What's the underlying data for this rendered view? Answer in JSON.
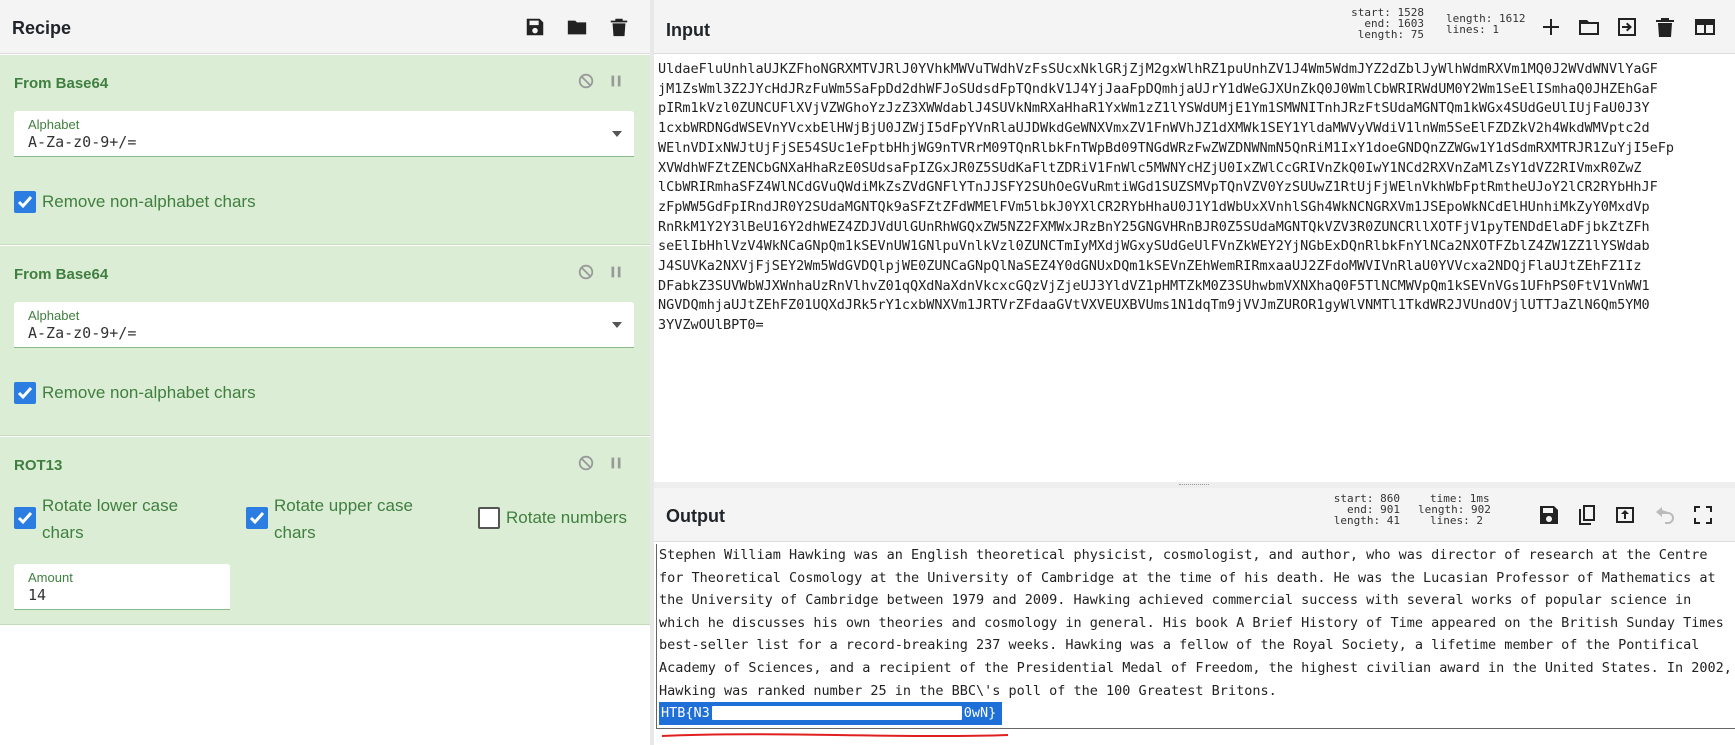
{
  "recipe": {
    "title": "Recipe",
    "icons": [
      "save-icon",
      "folder-icon",
      "trash-icon"
    ],
    "operations": [
      {
        "name": "From Base64",
        "alphabet_label": "Alphabet",
        "alphabet_value": "A-Za-z0-9+/=",
        "checkbox_label": "Remove non-alphabet chars",
        "checked": true
      },
      {
        "name": "From Base64",
        "alphabet_label": "Alphabet",
        "alphabet_value": "A-Za-z0-9+/=",
        "checkbox_label": "Remove non-alphabet chars",
        "checked": true
      },
      {
        "name": "ROT13",
        "opt_lower": "Rotate lower case chars",
        "opt_upper": "Rotate upper case chars",
        "opt_numbers": "Rotate numbers",
        "lower_checked": true,
        "upper_checked": true,
        "numbers_checked": false,
        "amount_label": "Amount",
        "amount_value": "14"
      }
    ]
  },
  "input": {
    "title": "Input",
    "stats": {
      "start": "start: 1528",
      "end": "end: 1603",
      "length": "length: 75",
      "total_length": "length: 1612",
      "lines": "lines: 1"
    },
    "icons": [
      "plus-icon",
      "open-folder-icon",
      "import-icon",
      "trash-icon",
      "layout-icon"
    ],
    "lines": [
      "UldaeFluUnhlaUJKZFhoNGRXMTVJRlJ0YVhkMWVuTWdhVzFsSUcxNklGRjZjM2gxWlhRZ1puUnhZV1J4Wm5WdmJYZ2dZblJyWlhWdmRXVm1MQ0J2WVdWNVlYaGF",
      "jM1ZsWml3Z2JYcHdJRzFuWm5SaFpDd2dhWFJoSUdsdFpTQndkV1J4YjJaaFpDQmhjaUJrY1dWeGJXUnZkQ0J0WmlCbWRIRWdUM0Y2Wm1SeElISmhaQ0JHZEhGaF",
      "pIRm1kVzl0ZUNCUFlXVjVZWGhoYzJzZ3XWWdablJ4SUVkNmRXaHhaR1YxWm1zZ1lYSWdUMjE1Ym1SMWNITnhJRzFtSUdaMGNTQm1kWGx4SUdGeUlIUjFaU0J3Y",
      "1cxbWRDNGdWSEVnYVcxbElHWjBjU0JZWjI5dFpYVnRlaUJDWkdGeWNXVmxZV1FnWVhJZ1dXMWk1SEY1YldaMWVyVWdiV1lnWm5SeElFZDZkV2h4WkdWMVptc2d",
      "WElnVDIxNWJtUjFjSE54SUc1eFptbHhjWG9nTVRrM09TQnRlbkFnTWpBd09TNGdWRzFwZWZDNWNmN5QnRiM1IxY1doeGNDQnZZWGw1Y1dSdmRXMTRJR1ZuYjI5eFp",
      "XVWdhWFZtZENCbGNXaHhaRzE0SUdsaFpIZGxJR0Z5SUdKaFltZDRiV1FnWlc5MWNYcHZjU0IxZWlCcGRIVnZkQ0IwY1NCd2RXVnZaMlZsY1dVZ2RIVmxR0ZwZ",
      "lCbWRIRmhaSFZ4WlNCdGVuQWdiMkZsZVdGNFlYTnJJSFY2SUhOeGVuRmtiWGd1SUZSMVpTQnVZV0YzSUUwZ1RtUjFjWElnVkhWbFptRmtheUJoY2lCR2RYbHhJF",
      "zFpWW5GdFpIRndJR0Y2SUdaMGNTQk9aSFZtZFdWMElFVm5lbkJ0YXlCR2RYbHhaU0J1Y1dWbUxXVnhlSGh4WkNCNGRXVm1JSEpoWkNCdElHUnhiMkZyY0MxdVp",
      "RnRkM1Y2Y3lBeU16Y2dhWEZ4ZDJVdUlGUnRhWGQxZW5NZ2FXMWxJRzBnY25GNGVHRnBJR0Z5SUdaMGNTQkVZV3R0ZUNCRllXOTFjV1pyTENDdElaDFjbkZtZFh",
      "seElIbHhlVzV4WkNCaGNpQm1kSEVnUW1GNlpuVnlkVzl0ZUNCTmIyMXdjWGxySUdGeUlFVnZkWEY2YjNGbExDQnRlbkFnYlNCa2NXOTFZblZ4ZW1ZZ1lYSWdab",
      "J4SUVKa2NXVjFjSEY2Wm5WdGVDQlpjWE0ZUNCaGNpQlNaSEZ4Y0dGNUxDQm1kSEVnZEhWemRIRmxaaUJ2ZFdoMWVIVnRlaU0YVVcxa2NDQjFlaUJtZEhFZ1Iz",
      "DFabkZ3SUVWbWJXWnhaUzRnVlhvZ01qQXdNaXdnVkcxcGQzVjZjeUJ3YldVZ1pHMTZkM0Z3SUhwbmVXNXhaQ0F5TlNCMWVpQm1kSEVnVGs1UFhPS0FtV1VnWW1",
      "NGVDQmhjaUJtZEhFZ01UQXdJRk5rY1cxbWNXVm1JRTVrZFdaaGVtVXVEUXBVUms1N1dqTm9jVVJmZUROR1gyWlVNMTl1TkdWR2JVUndOVjlUTTJaZlN6Qm5YM0",
      "3YVZwOUlBPT0="
    ]
  },
  "output": {
    "title": "Output",
    "stats": {
      "start": "start: 860",
      "end": "end: 901",
      "length": "length: 41",
      "time": "time: 1ms",
      "total_length": "length: 902",
      "lines": "lines: 2"
    },
    "icons": [
      "save-icon",
      "copy-icon",
      "replace-input-icon",
      "undo-icon",
      "fullscreen-icon"
    ],
    "text": "Stephen William Hawking was an English theoretical physicist, cosmologist, and author, who was director of research at the Centre for Theoretical Cosmology at the University of Cambridge at the time of his death. He was the Lucasian Professor of Mathematics at the University of Cambridge between 1979 and 2009. Hawking achieved commercial success with several works of popular science in which he discusses his own theories and cosmology in general. His book A Brief History of Time appeared on the British Sunday Times best-seller list for a record-breaking 237 weeks. Hawking was a fellow of the Royal Society, a lifetime member of the Pontifical Academy of Sciences, and a recipient of the Presidential Medal of Freedom, the highest civilian award in the United States. In 2002, Hawking was ranked number 25 in the BBC\\'s poll of the 100 Greatest Britons.",
    "flag_start": "HTB{N3",
    "flag_end": "0wN}"
  },
  "colors": {
    "operation_bg": "#dcedd6",
    "operation_title": "#3f7f3f",
    "checkbox": "#2b7de1",
    "selection": "#1e6fd8",
    "annotation": "#e02020"
  }
}
